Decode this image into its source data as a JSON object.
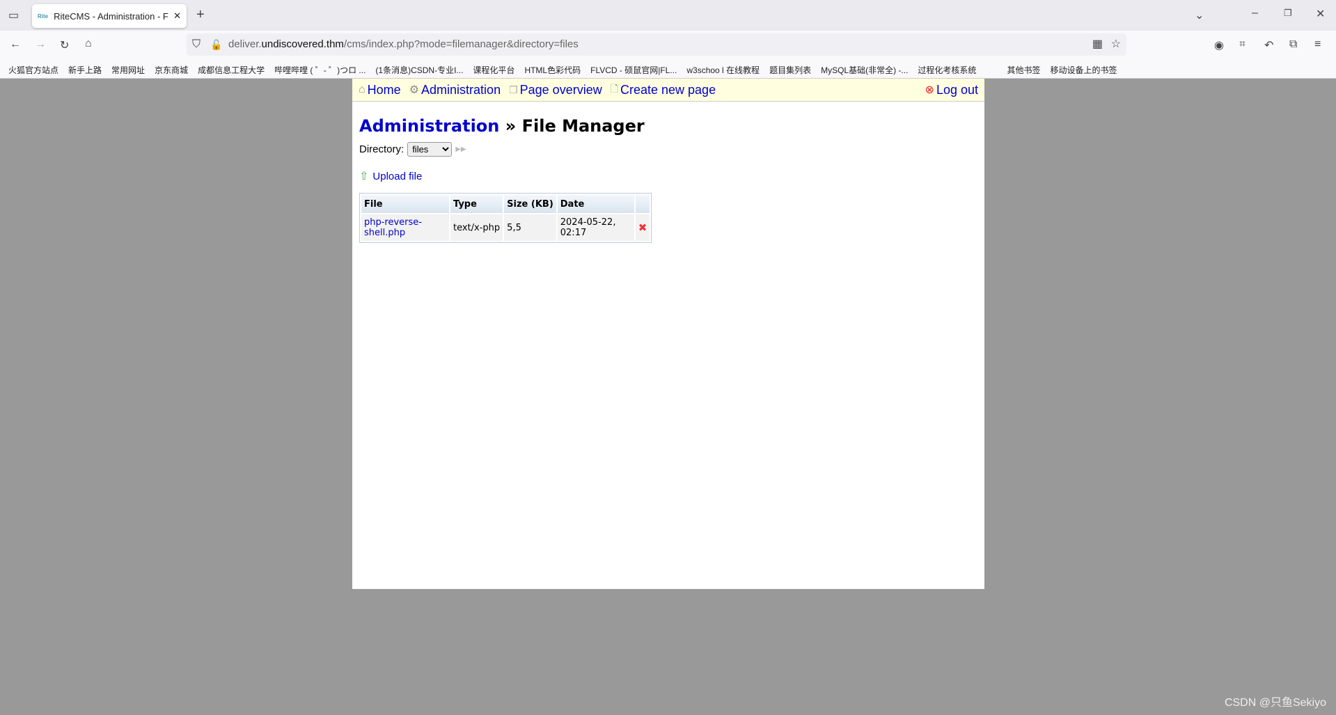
{
  "browser": {
    "tab_title": "RiteCMS - Administration - F",
    "tab_logo": "Rite",
    "url_prefix": "deliver.",
    "url_domain": "undiscovered.thm",
    "url_path": "/cms/index.php?mode=filemanager&directory=files",
    "bookmarks": [
      "火狐官方站点",
      "新手上路",
      "常用网址",
      "京东商城",
      "成都信息工程大学",
      "哔哩哔哩 ( ゜- ゜)つロ ...",
      "(1条消息)CSDN-专业I...",
      "课程化平台",
      "HTML色彩代码",
      "FLVCD - 硕鼠官网|FL...",
      "w3schoo l 在线教程",
      "题目集列表",
      "MySQL基础(非常全) -...",
      "过程化考核系统",
      "其他书签",
      "移动设备上的书签"
    ]
  },
  "nav": {
    "home": "Home",
    "administration": "Administration",
    "page_overview": "Page overview",
    "create_new_page": "Create new page",
    "logout": "Log out"
  },
  "heading": {
    "link": "Administration",
    "separator": " » ",
    "title": "File Manager"
  },
  "directory": {
    "label": "Directory:",
    "selected": "files"
  },
  "upload": "Upload file",
  "table": {
    "headers": [
      "File",
      "Type",
      "Size (KB)",
      "Date",
      ""
    ],
    "rows": [
      {
        "file": "php-reverse-shell.php",
        "type": "text/x-php",
        "size": "5,5",
        "date": "2024-05-22, 02:17"
      }
    ]
  },
  "watermark": "CSDN @只鱼Sekiyo"
}
